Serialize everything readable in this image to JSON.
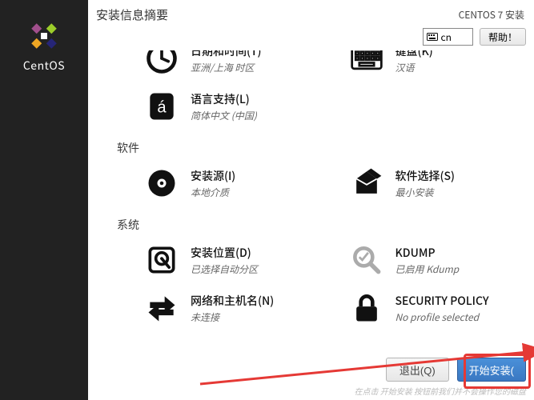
{
  "brand": "CentOS",
  "header": {
    "title": "安装信息摘要",
    "installer": "CENTOS 7 安装",
    "lang_code": "cn",
    "help": "帮助！"
  },
  "sections": {
    "localization": {
      "datetime": {
        "title": "日期和时间(T)",
        "sub": "亚洲/上海 时区"
      },
      "keyboard": {
        "title": "键盘(K)",
        "sub": "汉语"
      },
      "lang": {
        "title": "语言支持(L)",
        "sub": "简体中文 (中国)"
      }
    },
    "software_label": "软件",
    "software": {
      "source": {
        "title": "安装源(I)",
        "sub": "本地介质"
      },
      "selection": {
        "title": "软件选择(S)",
        "sub": "最小安装"
      }
    },
    "system_label": "系统",
    "system": {
      "dest": {
        "title": "安装位置(D)",
        "sub": "已选择自动分区"
      },
      "kdump": {
        "title": "KDUMP",
        "sub": "已启用 Kdump"
      },
      "network": {
        "title": "网络和主机名(N)",
        "sub": "未连接"
      },
      "secpol": {
        "title": "SECURITY POLICY",
        "sub": "No profile selected"
      }
    }
  },
  "footer": {
    "quit": "退出(Q)",
    "begin": "开始安装(",
    "hint": "在点击 开始安装 按钮前我们并不会操作您的磁盘"
  }
}
